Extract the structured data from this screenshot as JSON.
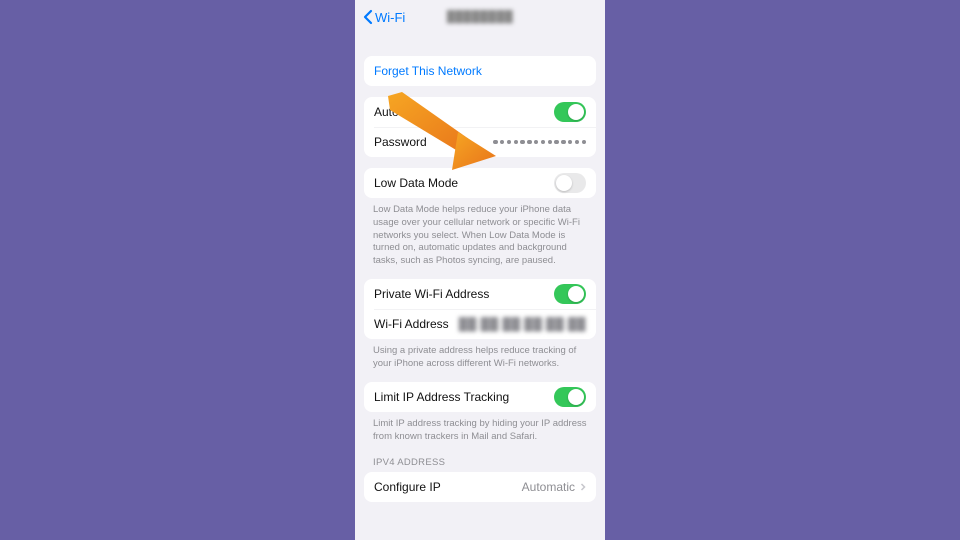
{
  "nav": {
    "back_label": "Wi-Fi",
    "title_obscured": "████████"
  },
  "forget": {
    "label": "Forget This Network"
  },
  "auto_join": {
    "label": "Auto-Join",
    "on": true
  },
  "password": {
    "label": "Password",
    "dot_count": 14
  },
  "low_data": {
    "label": "Low Data Mode",
    "on": false,
    "footer": "Low Data Mode helps reduce your iPhone data usage over your cellular network or specific Wi-Fi networks you select. When Low Data Mode is turned on, automatic updates and background tasks, such as Photos syncing, are paused."
  },
  "private_addr": {
    "label": "Private Wi-Fi Address",
    "on": true
  },
  "wifi_addr": {
    "label": "Wi-Fi Address",
    "value_obscured": "██:██:██:██:██:██"
  },
  "private_footer": "Using a private address helps reduce tracking of your iPhone across different Wi-Fi networks.",
  "limit_tracking": {
    "label": "Limit IP Address Tracking",
    "on": true,
    "footer": "Limit IP address tracking by hiding your IP address from known trackers in Mail and Safari."
  },
  "ipv4": {
    "header": "IPV4 ADDRESS",
    "configure_label": "Configure IP",
    "configure_value": "Automatic"
  }
}
